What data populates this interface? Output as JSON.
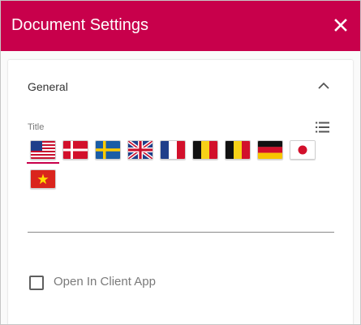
{
  "dialog": {
    "title": "Document Settings",
    "close_icon": "close-icon",
    "accent_color": "#c8004b"
  },
  "section": {
    "title": "General",
    "expanded": true,
    "collapse_icon": "chevron-up-icon"
  },
  "title_field": {
    "label": "Title",
    "language_list_icon": "list-icon",
    "selected_flag": "flag-us",
    "flags": [
      "flag-us",
      "flag-denmark",
      "flag-sweden",
      "flag-uk",
      "flag-france",
      "flag-belgium",
      "flag-belgium",
      "flag-germany",
      "flag-japan",
      "flag-vietnam"
    ],
    "value": ""
  },
  "open_in_client_app": {
    "label": "Open In Client App",
    "checked": false
  }
}
